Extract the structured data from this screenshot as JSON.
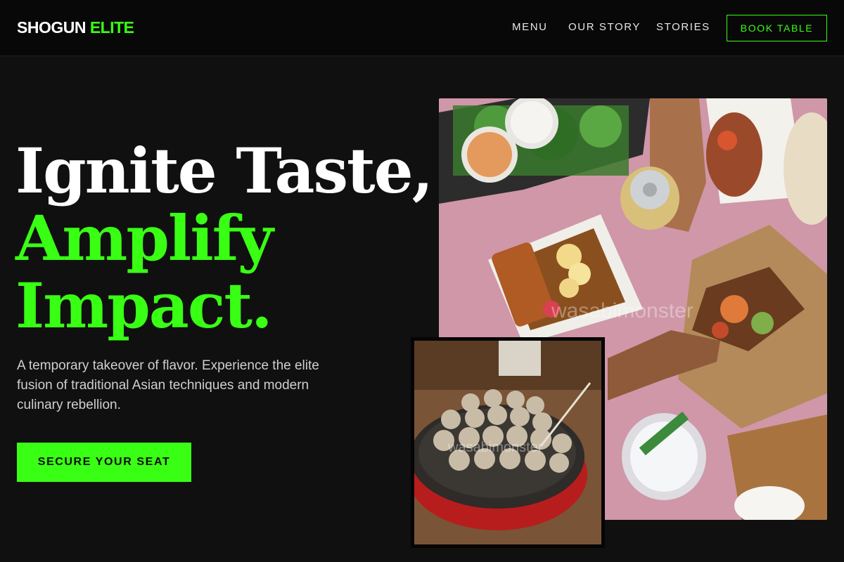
{
  "header": {
    "brand_part1": "SHOGUN",
    "brand_part2": "ELITE",
    "nav": {
      "menu": "MENU",
      "our_story": "OUR STORY",
      "stories": "STORIES"
    },
    "book_button": "BOOK TABLE"
  },
  "hero": {
    "headline_line1": "Ignite Taste,",
    "headline_line2": "Amplify",
    "headline_line3": "Impact.",
    "subtitle": "A temporary takeover of flavor. Experience the elite fusion of traditional Asian techniques and modern culinary rebellion.",
    "cta_button": "SECURE YOUR SEAT"
  },
  "images": {
    "main_watermark": "wasabimonster",
    "inset_watermark": "wasabimonster"
  },
  "colors": {
    "accent": "#39ff14",
    "background": "#101010",
    "header_background": "#080808"
  }
}
